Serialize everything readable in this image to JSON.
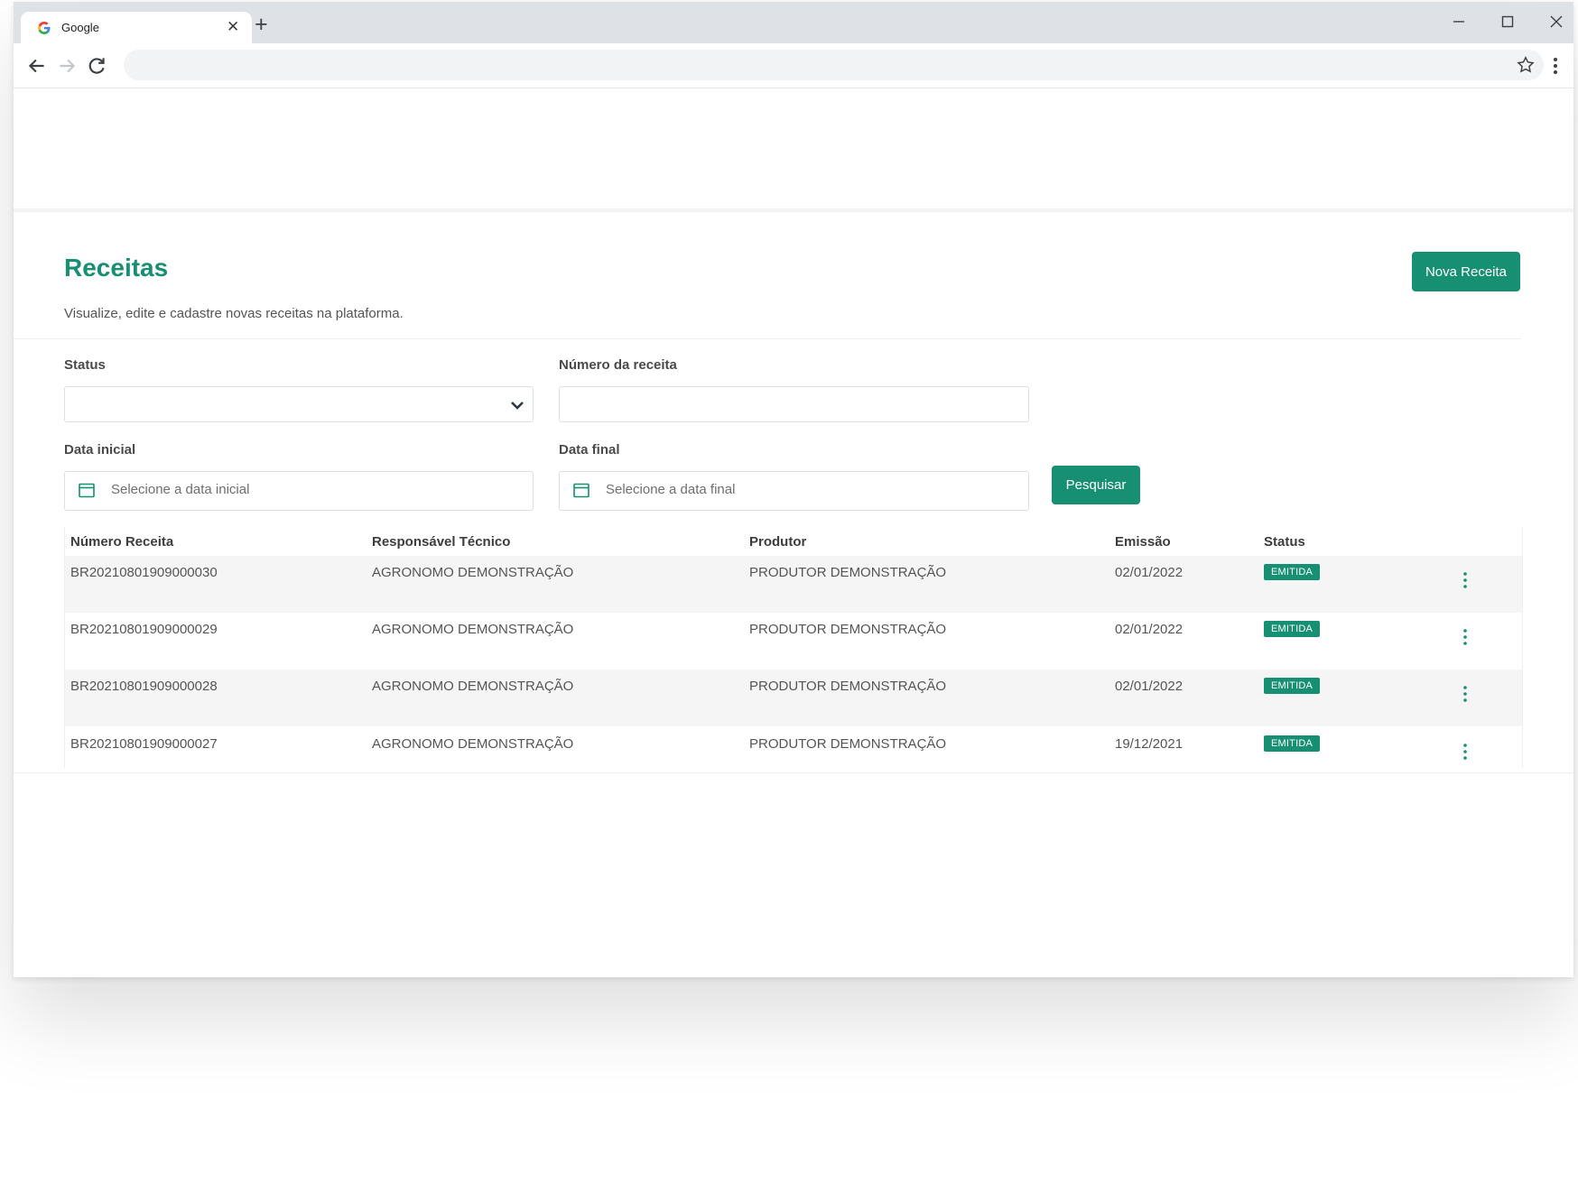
{
  "browser": {
    "tab_title": "Google",
    "tab_close": "✕",
    "new_tab": "+",
    "address": ""
  },
  "page": {
    "title": "Receitas",
    "subtitle": "Visualize, edite e cadastre novas receitas na plataforma.",
    "new_button": "Nova Receita",
    "accent_color": "#168f73"
  },
  "filters": {
    "status_label": "Status",
    "status_value": "",
    "number_label": "Número da receita",
    "number_value": "",
    "start_label": "Data inicial",
    "start_placeholder": "Selecione a data inicial",
    "end_label": "Data final",
    "end_placeholder": "Selecione a data final",
    "search_button": "Pesquisar"
  },
  "table": {
    "columns": [
      "Número Receita",
      "Responsável Técnico",
      "Produtor",
      "Emissão",
      "Status"
    ],
    "rows": [
      {
        "numero": "BR20210801909000030",
        "responsavel": "AGRONOMO DEMONSTRAÇÃO",
        "produtor": "PRODUTOR DEMONSTRAÇÃO",
        "emissao": "02/01/2022",
        "status": "EMITIDA"
      },
      {
        "numero": "BR20210801909000029",
        "responsavel": "AGRONOMO DEMONSTRAÇÃO",
        "produtor": "PRODUTOR DEMONSTRAÇÃO",
        "emissao": "02/01/2022",
        "status": "EMITIDA"
      },
      {
        "numero": "BR20210801909000028",
        "responsavel": "AGRONOMO DEMONSTRAÇÃO",
        "produtor": "PRODUTOR DEMONSTRAÇÃO",
        "emissao": "02/01/2022",
        "status": "EMITIDA"
      },
      {
        "numero": "BR20210801909000027",
        "responsavel": "AGRONOMO DEMONSTRAÇÃO",
        "produtor": "PRODUTOR DEMONSTRAÇÃO",
        "emissao": "19/12/2021",
        "status": "EMITIDA"
      }
    ]
  }
}
